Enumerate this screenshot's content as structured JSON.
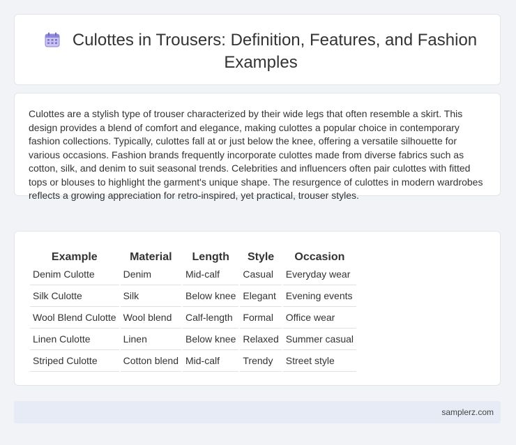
{
  "header": {
    "title": "Culottes in Trousers: Definition, Features, and Fashion Examples",
    "icon": "calendar-icon"
  },
  "intro": {
    "text": "Culottes are a stylish type of trouser characterized by their wide legs that often resemble a skirt. This design provides a blend of comfort and elegance, making culottes a popular choice in contemporary fashion collections. Typically, culottes fall at or just below the knee, offering a versatile silhouette for various occasions. Fashion brands frequently incorporate culottes made from diverse fabrics such as cotton, silk, and denim to suit seasonal trends. Celebrities and influencers often pair culottes with fitted tops or blouses to highlight the garment's unique shape. The resurgence of culottes in modern wardrobes reflects a growing appreciation for retro-inspired, yet practical, trouser styles."
  },
  "table": {
    "headers": [
      "Example",
      "Material",
      "Length",
      "Style",
      "Occasion"
    ],
    "rows": [
      [
        "Denim Culotte",
        "Denim",
        "Mid-calf",
        "Casual",
        "Everyday wear"
      ],
      [
        "Silk Culotte",
        "Silk",
        "Below knee",
        "Elegant",
        "Evening events"
      ],
      [
        "Wool Blend Culotte",
        "Wool blend",
        "Calf-length",
        "Formal",
        "Office wear"
      ],
      [
        "Linen Culotte",
        "Linen",
        "Below knee",
        "Relaxed",
        "Summer casual"
      ],
      [
        "Striped Culotte",
        "Cotton blend",
        "Mid-calf",
        "Trendy",
        "Street style"
      ]
    ]
  },
  "footer": {
    "site": "samplerz.com"
  }
}
